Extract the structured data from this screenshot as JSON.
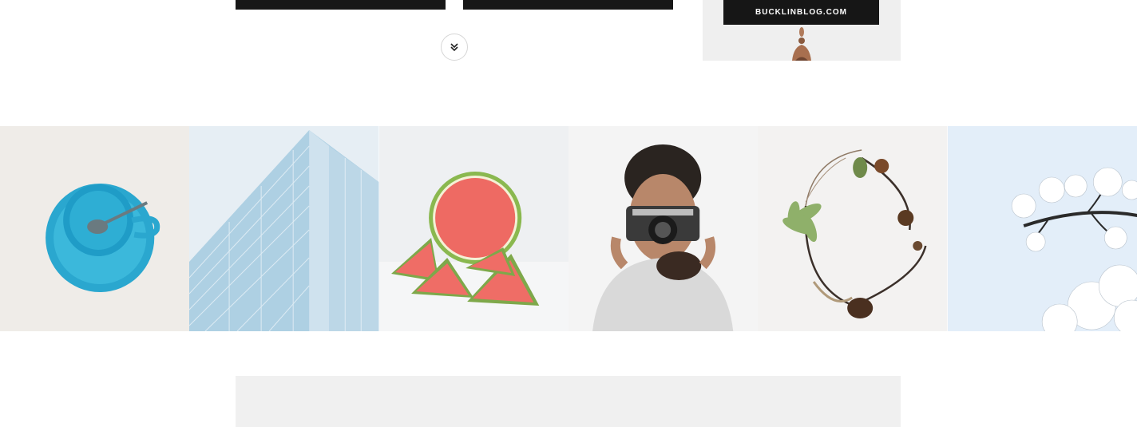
{
  "sidebar_ad": {
    "banner_text": "BUCKLINBLOG.COM"
  },
  "pagination": {
    "load_more_icon": "double-chevron-down-icon"
  },
  "instagram_feed": {
    "items": [
      {
        "icon": "blue-teacup-photo"
      },
      {
        "icon": "glass-building-photo"
      },
      {
        "icon": "watermelon-slices-photo"
      },
      {
        "icon": "photographer-camera-photo"
      },
      {
        "icon": "branch-wreath-photo"
      },
      {
        "icon": "white-blossom-branch-photo"
      }
    ]
  },
  "colors": {
    "dark": "#171717",
    "light_gray": "#f0f0f0",
    "border": "#d6d6d6"
  }
}
